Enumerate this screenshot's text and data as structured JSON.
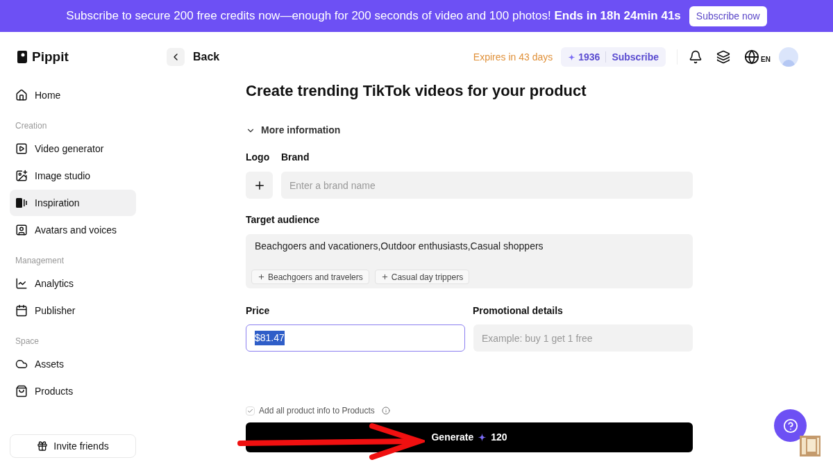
{
  "banner": {
    "message": "Subscribe to secure 200 free credits now—enough for 200 seconds of video and 100 photos!",
    "countdown": "Ends in 18h 24min 41s",
    "button": "Subscribe now"
  },
  "brand": {
    "name": "Pippit"
  },
  "header": {
    "back": "Back",
    "expires": "Expires in 43 days",
    "credits": "1936",
    "subscribe": "Subscribe",
    "language": "EN"
  },
  "sidebar": {
    "sections": [
      {
        "items": [
          {
            "label": "Home",
            "selected": false
          }
        ]
      },
      {
        "heading": "Creation",
        "items": [
          {
            "label": "Video generator",
            "selected": false
          },
          {
            "label": "Image studio",
            "selected": false
          },
          {
            "label": "Inspiration",
            "selected": true
          },
          {
            "label": "Avatars and voices",
            "selected": false
          }
        ]
      },
      {
        "heading": "Management",
        "items": [
          {
            "label": "Analytics",
            "selected": false
          },
          {
            "label": "Publisher",
            "selected": false
          }
        ]
      },
      {
        "heading": "Space",
        "items": [
          {
            "label": "Assets",
            "selected": false
          },
          {
            "label": "Products",
            "selected": false
          }
        ]
      }
    ],
    "invite": "Invite friends"
  },
  "form": {
    "title": "Create trending TikTok videos for your product",
    "more_info": {
      "label": "More information",
      "expanded": true
    },
    "logo_label": "Logo",
    "brand_label": "Brand",
    "brand_placeholder": "Enter a brand name",
    "audience_label": "Target audience",
    "audience_value": "Beachgoers and vacationers,Outdoor enthusiasts,Casual shoppers",
    "suggestions": [
      "Beachgoers and travelers",
      "Casual day trippers"
    ],
    "price_label": "Price",
    "price_value": "$81.47",
    "promo_label": "Promotional details",
    "promo_placeholder": "Example: buy 1 get 1 free",
    "add_to_products": {
      "label": "Add all product info to Products",
      "checked": true
    },
    "generate": {
      "label": "Generate",
      "cost": "120"
    }
  }
}
